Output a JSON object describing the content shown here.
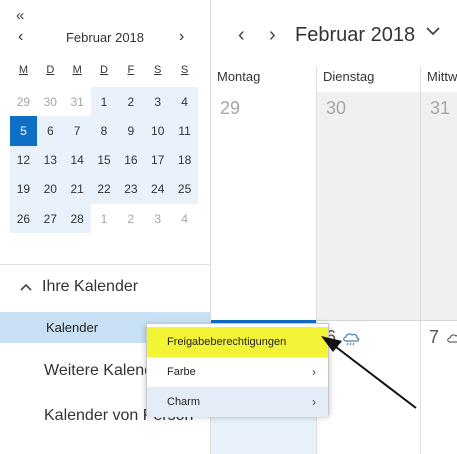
{
  "sidebar": {
    "collapse_glyph": "«",
    "mini_calendar": {
      "title": "Februar 2018",
      "prev_glyph": "‹",
      "next_glyph": "›",
      "weekdays": [
        "M",
        "D",
        "M",
        "D",
        "F",
        "S",
        "S"
      ],
      "weeks": [
        [
          "29",
          "30",
          "31",
          "1",
          "2",
          "3",
          "4"
        ],
        [
          "5",
          "6",
          "7",
          "8",
          "9",
          "10",
          "11"
        ],
        [
          "12",
          "13",
          "14",
          "15",
          "16",
          "17",
          "18"
        ],
        [
          "19",
          "20",
          "21",
          "22",
          "23",
          "24",
          "25"
        ],
        [
          "26",
          "27",
          "28",
          "1",
          "2",
          "3",
          "4"
        ]
      ],
      "selected_day": "5"
    },
    "section_title": "Ihre Kalender",
    "calendar_item": "Kalender",
    "other_items": [
      "Weitere Kalender",
      "Kalender von Person"
    ]
  },
  "main": {
    "title": "Februar 2018",
    "prev_glyph": "‹",
    "next_glyph": "›",
    "days": [
      "Montag",
      "Dienstag",
      "Mittwoch"
    ],
    "week1": [
      "29",
      "30",
      "31"
    ],
    "week2": [
      "6",
      "7"
    ],
    "weather_icons": [
      "rain-cloud-icon",
      "cloud-icon"
    ]
  },
  "context_menu": {
    "items": [
      {
        "label": "Freigabeberechtigungen",
        "highlighted": true
      },
      {
        "label": "Farbe",
        "submenu": true
      },
      {
        "label": "Charm",
        "submenu": true
      }
    ],
    "chevron_glyph": "›",
    "highlight_color": "#f4f437"
  },
  "colors": {
    "accent": "#0f6fc6",
    "selection": "#c7e0f4",
    "range": "#e9f2fb"
  }
}
